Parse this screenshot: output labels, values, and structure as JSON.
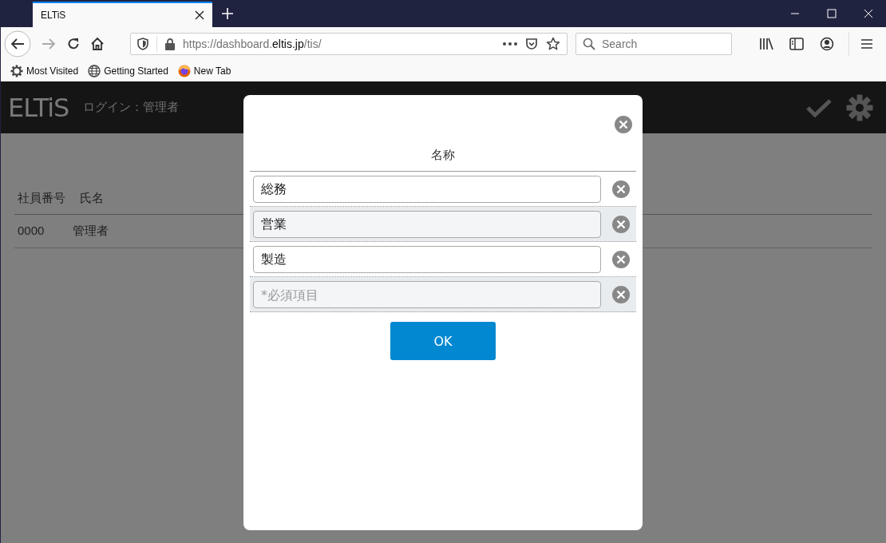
{
  "browser": {
    "tab": {
      "title": "ELTiS",
      "selected": true
    },
    "url": "https://dashboard.**eltis.jp**/tis/",
    "search": {
      "placeholder": "Search"
    },
    "bookmarks": [
      {
        "label": "Most Visited",
        "kind": "gear"
      },
      {
        "label": "Getting Started",
        "kind": "globe"
      },
      {
        "label": "New Tab",
        "kind": "firefox"
      }
    ]
  },
  "app": {
    "logo": "ELTiS",
    "login": "ログイン：管理者",
    "table": {
      "columns": [
        "社員番号",
        "氏名"
      ],
      "rows": [
        {
          "cells": [
            "0000",
            "管理者"
          ]
        }
      ]
    }
  },
  "dialog": {
    "heading": "名称",
    "rows": [
      {
        "value": "総務"
      },
      {
        "value": "営業"
      },
      {
        "value": "製造"
      },
      {
        "placeholder": "*必須項目"
      }
    ],
    "ok": "OK"
  }
}
